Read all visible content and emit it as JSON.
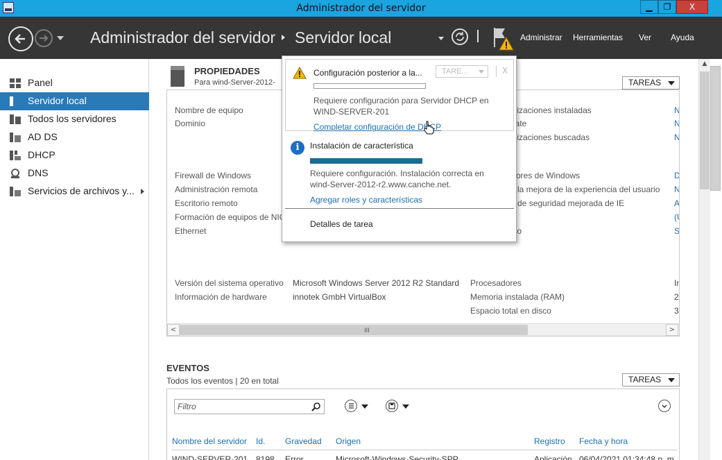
{
  "window": {
    "title": "Administrador del servidor",
    "minimize_label": "▁",
    "maximize_label": "❐",
    "close_label": "X"
  },
  "header": {
    "breadcrumb_root": "Administrador del servidor",
    "breadcrumb_current": "Servidor local",
    "menu": [
      "Administrar",
      "Herramientas",
      "Ver",
      "Ayuda"
    ]
  },
  "sidebar": {
    "items": [
      {
        "label": "Panel",
        "icon": "dashboard-icon"
      },
      {
        "label": "Servidor local",
        "icon": "local-server-icon",
        "active": true
      },
      {
        "label": "Todos los servidores",
        "icon": "all-servers-icon"
      },
      {
        "label": "AD DS",
        "icon": "ad-ds-icon"
      },
      {
        "label": "DHCP",
        "icon": "dhcp-icon"
      },
      {
        "label": "DNS",
        "icon": "dns-icon"
      },
      {
        "label": "Servicios de archivos y...",
        "icon": "file-services-icon"
      }
    ]
  },
  "properties": {
    "title": "PROPIEDADES",
    "subtitle": "Para wind-Server-2012-",
    "tasks_label": "TAREAS",
    "left_labels": [
      "Nombre de equipo",
      "Dominio",
      "Firewall de Windows",
      "Administración remota",
      "Escritorio remoto",
      "Formación de equipos de NIC",
      "Ethernet"
    ],
    "right_labels": [
      "alizaciones instaladas",
      "date",
      "alizaciones buscadas",
      "rrores de Windows",
      "a la mejora de la experiencia del usuario",
      "n de seguridad mejorada de IE",
      "cto"
    ],
    "right_values": [
      "N",
      "N",
      "N",
      "D",
      "N",
      "A",
      "(U",
      "S"
    ],
    "os_label": "Versión del sistema operativo",
    "os_value": "Microsoft Windows Server 2012 R2 Standard",
    "hw_label": "Información de hardware",
    "hw_value": "innotek GmbH VirtualBox",
    "cpu_label": "Procesadores",
    "cpu_value": "In",
    "ram_label": "Memoria instalada (RAM)",
    "ram_value": "2",
    "disk_label": "Espacio total en disco",
    "disk_value": "3",
    "scroll_left": "<",
    "scroll_right": ">",
    "scroll_grip": "III"
  },
  "events": {
    "title": "EVENTOS",
    "subtitle": "Todos los eventos | 20 en total",
    "tasks_label": "TAREAS",
    "filter_placeholder": "Filtro",
    "columns": [
      "Nombre del servidor",
      "Id.",
      "Gravedad",
      "Origen",
      "Registro",
      "Fecha y hora"
    ],
    "row": [
      "WIND-SERVER-201",
      "8198",
      "Error",
      "Microsoft-Windows-Security-SPP",
      "Aplicación",
      "06/04/2021 01:34:48 p. m."
    ]
  },
  "notifications": {
    "item1": {
      "title": "Configuración posterior a la...",
      "tasks_label": "TARE...",
      "close_label": "X",
      "progress": 0,
      "text_line1": "Requiere configuración para Servidor DHCP en",
      "text_line2": "WIND-SERVER-201",
      "link": "Completar configuración de DHCP"
    },
    "item2": {
      "title": "Instalación de característica",
      "progress": 1,
      "text_line1": "Requiere configuración. Instalación correcta en",
      "text_line2": "wind-Server-2012-r2.www.canche.net.",
      "link": "Agregar roles y características"
    },
    "task_details": "Detalles de tarea"
  },
  "colors": {
    "titlebar": "#1aa4e0",
    "header": "#363636",
    "active_item": "#2a7ab8",
    "link": "#1d6fb0",
    "progress": "#1a6d95",
    "warning": "#f5b800"
  }
}
